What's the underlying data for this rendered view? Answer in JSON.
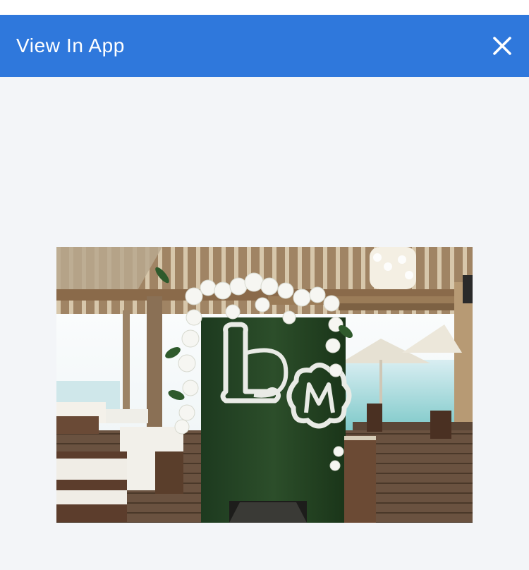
{
  "app_bar": {
    "title": "View In App",
    "close_icon": "close-icon",
    "background_color": "#2f78dc",
    "text_color": "#ffffff"
  },
  "photo": {
    "subject_icon": "photo",
    "background_color": "#f3f5f8"
  }
}
